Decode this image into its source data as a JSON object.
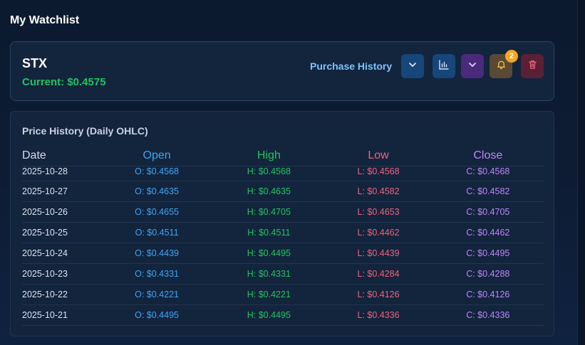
{
  "page": {
    "title": "My Watchlist"
  },
  "stock": {
    "symbol": "STX",
    "current_label": "Current: $0.4575",
    "purchase_history_label": "Purchase History",
    "alert_count": "2"
  },
  "icons": {
    "expand": "chevron-down-icon",
    "chart": "bar-chart-icon",
    "more": "chevron-down-icon",
    "alert": "bell-icon",
    "delete": "trash-icon"
  },
  "colors": {
    "open": "#3ba7f5",
    "high": "#22c55e",
    "low": "#f0637a",
    "close": "#c084fc",
    "current": "#22c55e"
  },
  "history": {
    "title": "Price History (Daily OHLC)",
    "headers": {
      "date": "Date",
      "open": "Open",
      "high": "High",
      "low": "Low",
      "close": "Close"
    },
    "rows": [
      {
        "date": "2025-10-28",
        "open": "O: $0.4568",
        "high": "H: $0.4568",
        "low": "L: $0.4568",
        "close": "C: $0.4568"
      },
      {
        "date": "2025-10-27",
        "open": "O: $0.4635",
        "high": "H: $0.4635",
        "low": "L: $0.4582",
        "close": "C: $0.4582"
      },
      {
        "date": "2025-10-26",
        "open": "O: $0.4655",
        "high": "H: $0.4705",
        "low": "L: $0.4653",
        "close": "C: $0.4705"
      },
      {
        "date": "2025-10-25",
        "open": "O: $0.4511",
        "high": "H: $0.4511",
        "low": "L: $0.4462",
        "close": "C: $0.4462"
      },
      {
        "date": "2025-10-24",
        "open": "O: $0.4439",
        "high": "H: $0.4495",
        "low": "L: $0.4439",
        "close": "C: $0.4495"
      },
      {
        "date": "2025-10-23",
        "open": "O: $0.4331",
        "high": "H: $0.4331",
        "low": "L: $0.4284",
        "close": "C: $0.4288"
      },
      {
        "date": "2025-10-22",
        "open": "O: $0.4221",
        "high": "H: $0.4221",
        "low": "L: $0.4126",
        "close": "C: $0.4126"
      },
      {
        "date": "2025-10-21",
        "open": "O: $0.4495",
        "high": "H: $0.4495",
        "low": "L: $0.4336",
        "close": "C: $0.4336"
      }
    ]
  }
}
